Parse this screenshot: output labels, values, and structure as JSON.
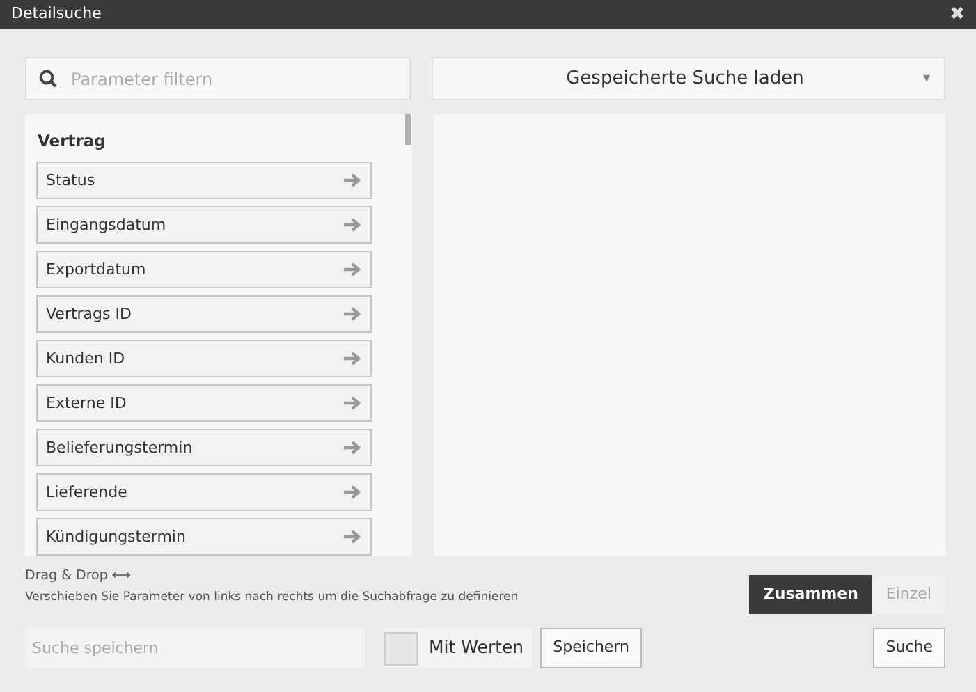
{
  "window": {
    "title": "Detailsuche",
    "close": "✖"
  },
  "filter": {
    "placeholder": "Parameter filtern"
  },
  "saved_search": {
    "label": "Gespeicherte Suche laden",
    "caret": "▾"
  },
  "parameters": {
    "group": "Vertrag",
    "items": [
      {
        "label": "Status"
      },
      {
        "label": "Eingangsdatum"
      },
      {
        "label": "Exportdatum"
      },
      {
        "label": "Vertrags ID"
      },
      {
        "label": "Kunden ID"
      },
      {
        "label": "Externe ID"
      },
      {
        "label": "Belieferungstermin"
      },
      {
        "label": "Lieferende"
      },
      {
        "label": "Kündigungstermin"
      }
    ]
  },
  "hint": {
    "title": "Drag & Drop ⟷",
    "text": "Verschieben Sie Parameter von links nach rechts um die Suchabfrage zu definieren"
  },
  "mode": [
    {
      "label": "Zusammen",
      "selected": true
    },
    {
      "label": "Einzel",
      "selected": false
    }
  ],
  "save": {
    "placeholder": "Suche speichern",
    "with_values": {
      "label": "Mit Werten",
      "checked": false
    },
    "button": "Speichern"
  },
  "search_button": "Suche"
}
